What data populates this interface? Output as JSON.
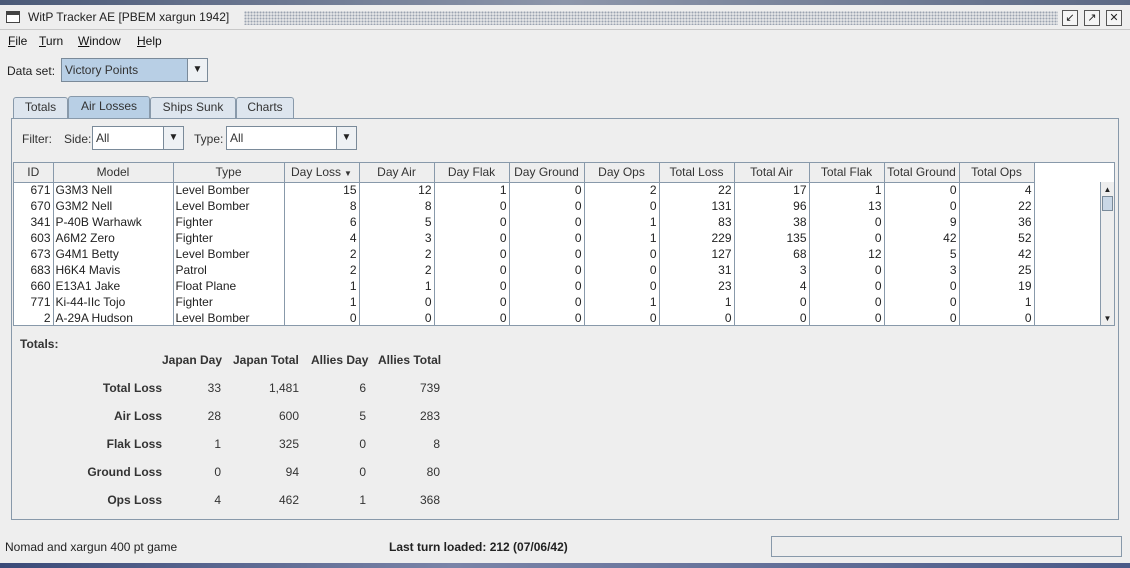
{
  "window": {
    "title": "WitP Tracker AE [PBEM xargun 1942]",
    "controls": [
      "restore-down-icon",
      "maximize-icon",
      "close-icon"
    ]
  },
  "menu": {
    "items": [
      {
        "mnemonic": "F",
        "rest": "ile"
      },
      {
        "mnemonic": "T",
        "rest": "urn"
      },
      {
        "mnemonic": "W",
        "rest": "indow"
      },
      {
        "mnemonic": "H",
        "rest": "elp"
      }
    ]
  },
  "dataset": {
    "label": "Data set:",
    "value": "Victory Points"
  },
  "tabs": [
    {
      "label": "Totals",
      "active": false
    },
    {
      "label": "Air Losses",
      "active": true
    },
    {
      "label": "Ships Sunk",
      "active": false
    },
    {
      "label": "Charts",
      "active": false
    }
  ],
  "filter": {
    "label": "Filter:",
    "side_label": "Side:",
    "side_value": "All",
    "type_label": "Type:",
    "type_value": "All"
  },
  "table": {
    "columns": [
      "ID",
      "Model",
      "Type",
      "Day Loss",
      "Day Air",
      "Day Flak",
      "Day Ground",
      "Day Ops",
      "Total Loss",
      "Total Air",
      "Total Flak",
      "Total Ground",
      "Total Ops"
    ],
    "sorted_column": "Day Loss",
    "sort_direction": "descending",
    "rows": [
      [
        "671",
        "G3M3 Nell",
        "Level Bomber",
        "15",
        "12",
        "1",
        "0",
        "2",
        "22",
        "17",
        "1",
        "0",
        "4"
      ],
      [
        "670",
        "G3M2 Nell",
        "Level Bomber",
        "8",
        "8",
        "0",
        "0",
        "0",
        "131",
        "96",
        "13",
        "0",
        "22"
      ],
      [
        "341",
        "P-40B Warhawk",
        "Fighter",
        "6",
        "5",
        "0",
        "0",
        "1",
        "83",
        "38",
        "0",
        "9",
        "36"
      ],
      [
        "603",
        "A6M2 Zero",
        "Fighter",
        "4",
        "3",
        "0",
        "0",
        "1",
        "229",
        "135",
        "0",
        "42",
        "52"
      ],
      [
        "673",
        "G4M1 Betty",
        "Level Bomber",
        "2",
        "2",
        "0",
        "0",
        "0",
        "127",
        "68",
        "12",
        "5",
        "42"
      ],
      [
        "683",
        "H6K4 Mavis",
        "Patrol",
        "2",
        "2",
        "0",
        "0",
        "0",
        "31",
        "3",
        "0",
        "3",
        "25"
      ],
      [
        "660",
        "E13A1 Jake",
        "Float Plane",
        "1",
        "1",
        "0",
        "0",
        "0",
        "23",
        "4",
        "0",
        "0",
        "19"
      ],
      [
        "771",
        "Ki-44-IIc Tojo",
        "Fighter",
        "1",
        "0",
        "0",
        "0",
        "1",
        "1",
        "0",
        "0",
        "0",
        "1"
      ],
      [
        "2",
        "A-29A Hudson",
        "Level Bomber",
        "0",
        "0",
        "0",
        "0",
        "0",
        "0",
        "0",
        "0",
        "0",
        "0"
      ]
    ]
  },
  "totals": {
    "heading": "Totals:",
    "columns": [
      "Japan Day",
      "Japan Total",
      "Allies Day",
      "Allies Total"
    ],
    "rows": [
      {
        "label": "Total Loss",
        "values": [
          "33",
          "1,481",
          "6",
          "739"
        ]
      },
      {
        "label": "Air Loss",
        "values": [
          "28",
          "600",
          "5",
          "283"
        ]
      },
      {
        "label": "Flak Loss",
        "values": [
          "1",
          "325",
          "0",
          "8"
        ]
      },
      {
        "label": "Ground Loss",
        "values": [
          "0",
          "94",
          "0",
          "80"
        ]
      },
      {
        "label": "Ops Loss",
        "values": [
          "4",
          "462",
          "1",
          "368"
        ]
      }
    ]
  },
  "status": {
    "game": "Nomad and xargun 400 pt game",
    "last_turn_label": "Last turn loaded:",
    "last_turn_value": "212 (07/06/42)"
  }
}
